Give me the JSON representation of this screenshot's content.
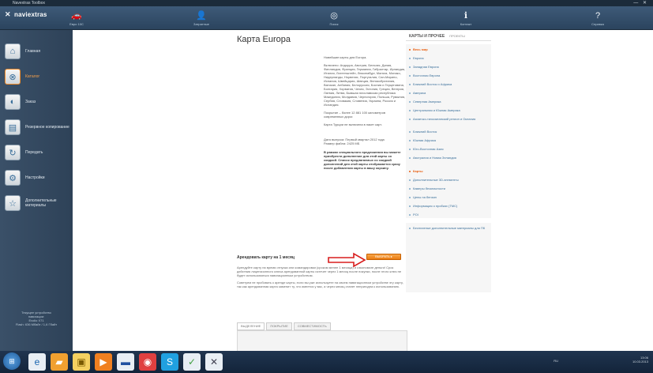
{
  "window": {
    "title": "Navextras Toolbox",
    "controls": "— ✕"
  },
  "app": {
    "logo": "naviextras"
  },
  "topnav": [
    {
      "label": "Евро 10С",
      "icon": "car-icon"
    },
    {
      "label": "Затратные",
      "icon": "person-icon"
    },
    {
      "label": "Поиск",
      "icon": "headset-icon"
    },
    {
      "label": "Контакт",
      "icon": "info-icon"
    },
    {
      "label": "Справка",
      "icon": "question-icon"
    }
  ],
  "sidebar": {
    "items": [
      {
        "label": "Главная",
        "icon": "home-icon",
        "active": false
      },
      {
        "label": "Каталог",
        "icon": "catalog-icon",
        "active": true
      },
      {
        "label": "Заказ",
        "icon": "cart-icon",
        "active": false
      },
      {
        "label": "Резервное копирование",
        "icon": "backup-icon",
        "active": false
      },
      {
        "label": "Передать",
        "icon": "sync-icon",
        "active": false
      },
      {
        "label": "Настройки",
        "icon": "settings-icon",
        "active": false
      },
      {
        "label": "Дополнительные материалы",
        "icon": "star-icon",
        "active": false
      }
    ],
    "device": {
      "line1": "Текущее устройство",
      "line2": "навигации:",
      "line3": "Evolio X71",
      "line4": "Flash: 636 Мбайт / 1,6 Гбайт"
    }
  },
  "content": {
    "title": "Карта Europa",
    "desc": [
      "Новейшие карты для Europa.",
      "Включено: Андорра, Австрия, Бельгия, Дания, Финляндия, Франция, Германия, Гибралтар, Ирландия, Италия, Лихтенштейн, Люксембург, Мальта, Монако, Нидерланды, Норвегия, Португалия, Сан-Марино, Испания, Швейцария, Швеция, Великобритания, Ватикан, Албания, Белоруссия, Босния и Герцеговина, Болгария, Хорватия, Чехия, Эстония, Греция, Венгрия, Латвия, Литва, Бывшая югославская республика Македония, Молдавия, Черногория, Польша, Румыния, Сербия, Словакия, Словения, Украина, Россия и Исландия.",
      "Покрытие – более 12 881 100 километров современных дорог.",
      "Карта Турции не включена в пакет карт.",
      "Дата выпуска: Первый квартал 2012 года",
      "Размер файла: 2425 МБ"
    ],
    "promo": "В рамках специального предложения вы можете приобрести дополнение для этой карты со скидкой. Список предлагаемых со скидкой дополнений для этой карты отображается сразу после добавления карты в вашу корзину.",
    "rent": {
      "title": "Арендовать карту на 1 месяц",
      "button": "ВЫБРАТЬ ▸",
      "p1": "Арендуйте карту на время отпуска или командировки (сроком менее 1 месяца) и сэкономьте деньги! Срок действия лицензионного ключа арендованной карты истечет через 1 месяц после покупки, после этого ключ не будет использоваться навигационным устройством.",
      "p2": "Советуем не пробовать к аренде карты, если вы уже используете на своем навигационном устройстве эту карту, так как арендованная карта заменит ту, что имеется у вас, а через месяц станет непригодна к использованию."
    },
    "tabs": [
      "ВЫДЕЛЕНИЕ",
      "ПОКРЫТИЕ",
      "СОВМЕСТИМОСТЬ"
    ]
  },
  "categories": {
    "header": "КАРТЫ И ПРОЧЕЕ",
    "header2": "ПРОЕКТЫ",
    "regions": [
      {
        "label": "Весь мир",
        "selected": true
      },
      {
        "label": "Европа",
        "selected": false
      },
      {
        "label": "Западная Европа",
        "selected": false
      },
      {
        "label": "Восточная Европа",
        "selected": false
      },
      {
        "label": "Ближний Восток и Африка",
        "selected": false
      },
      {
        "label": "Америка",
        "selected": false
      },
      {
        "label": "Северная Америка",
        "selected": false
      },
      {
        "label": "Центральная и Южная Америка",
        "selected": false
      },
      {
        "label": "Азиатско-тихоокеанский регион и Океания",
        "selected": false
      },
      {
        "label": "Ближний Восток",
        "selected": false
      },
      {
        "label": "Южная Африка",
        "selected": false
      },
      {
        "label": "Юго-Восточная Азия",
        "selected": false
      },
      {
        "label": "Австралия и Новая Зеландия",
        "selected": false
      }
    ],
    "types": [
      {
        "label": "Карты",
        "selected": true
      },
      {
        "label": "Дополнительные 3D-элементы",
        "selected": false
      },
      {
        "label": "Камеры безопасности",
        "selected": false
      },
      {
        "label": "Цены на бензин",
        "selected": false
      },
      {
        "label": "Информация о пробках (TMC)",
        "selected": false
      },
      {
        "label": "POI",
        "selected": false
      },
      {
        "label": "Бесплатные дополнительные материалы для ПК",
        "selected": false
      }
    ]
  },
  "taskbar": {
    "time": "13:06",
    "date": "10.03.2013",
    "lang": "RU"
  }
}
